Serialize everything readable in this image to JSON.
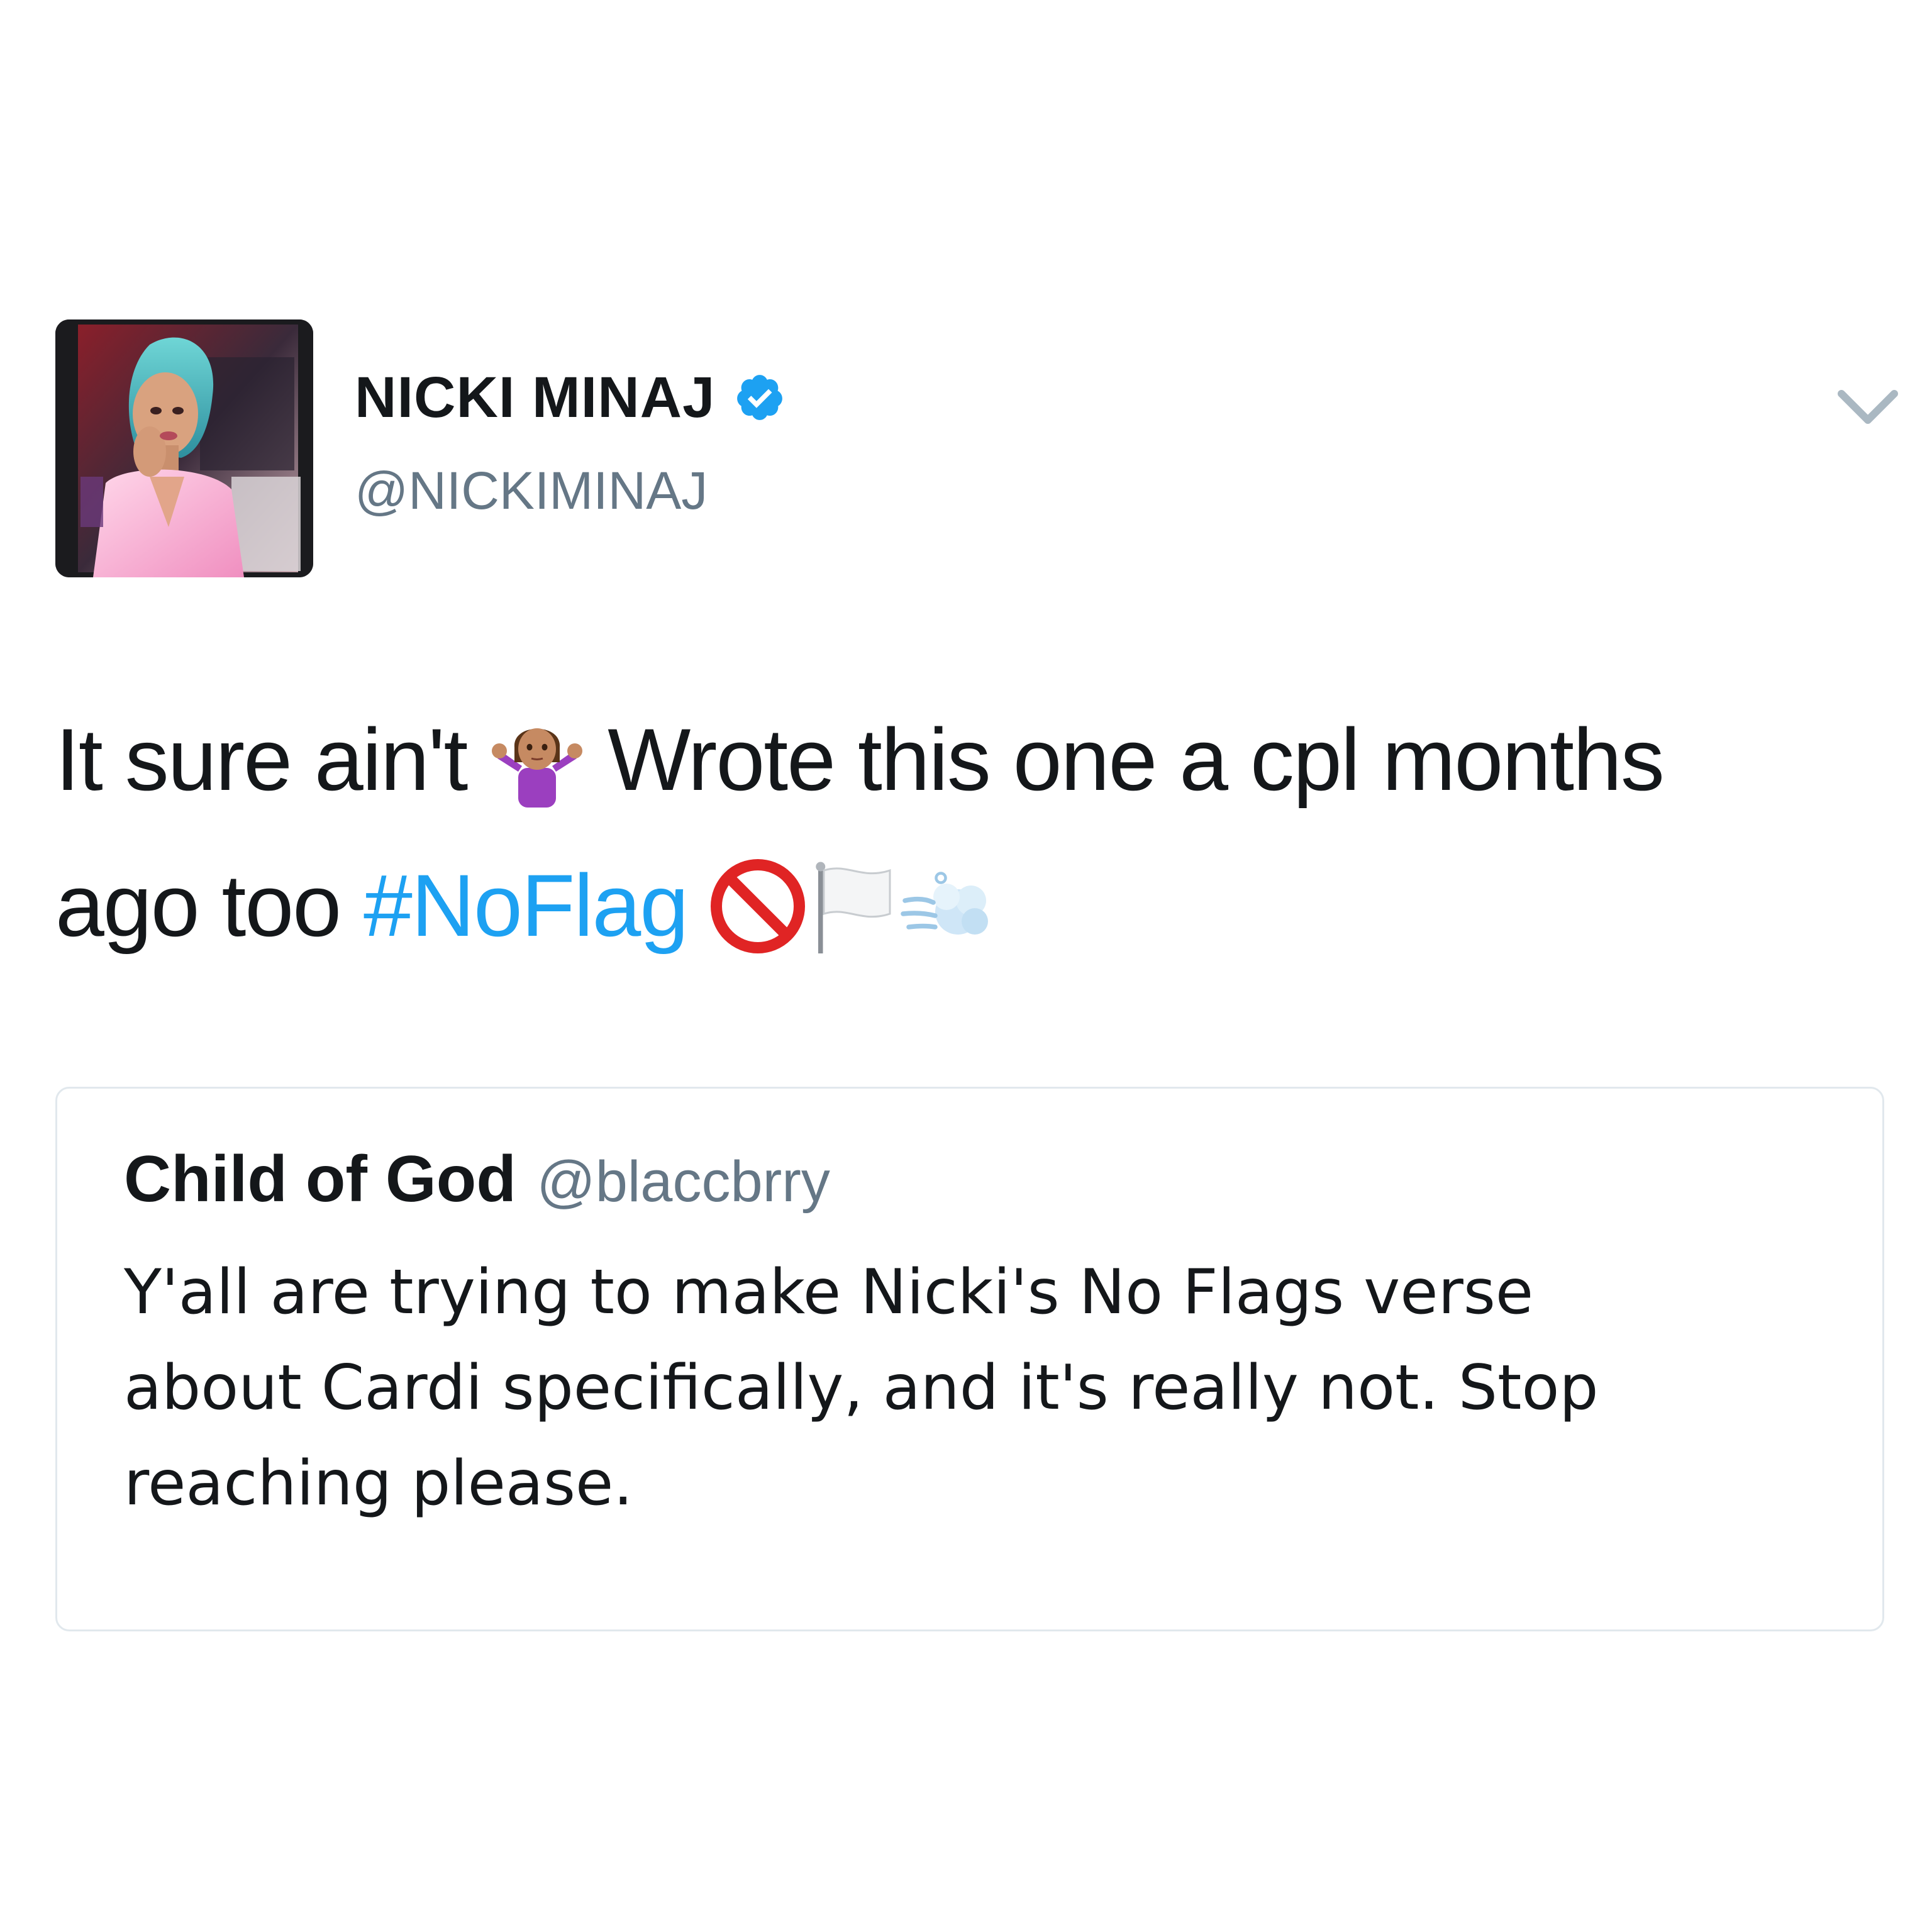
{
  "author": {
    "display_name": "NICKI MINAJ",
    "handle": "@NICKIMINAJ",
    "verified": true,
    "avatar_icon": "profile-photo"
  },
  "tweet": {
    "line1_before_emoji": "It sure ain't",
    "line1_emoji": "woman-shrugging-emoji",
    "line1_after_emoji": "Wrote this one a cpl months",
    "line2_before_hashtag": "ago too",
    "hashtag": "#NoFlag",
    "trailing_emojis": [
      "no-entry-sign-emoji",
      "white-flag-emoji",
      "dash-emoji"
    ]
  },
  "quoted_tweet": {
    "display_name": "Child of God",
    "handle": "@blaccbrry",
    "lines": [
      "Y'all are trying to make Nicki's No Flags verse",
      "about Cardi specifically, and it's really not. Stop",
      "reaching please."
    ]
  },
  "colors": {
    "link": "#1da1f2",
    "verified": "#1da1f2",
    "secondary_text": "#657786",
    "border": "#e1e8ed",
    "text": "#14171a"
  }
}
